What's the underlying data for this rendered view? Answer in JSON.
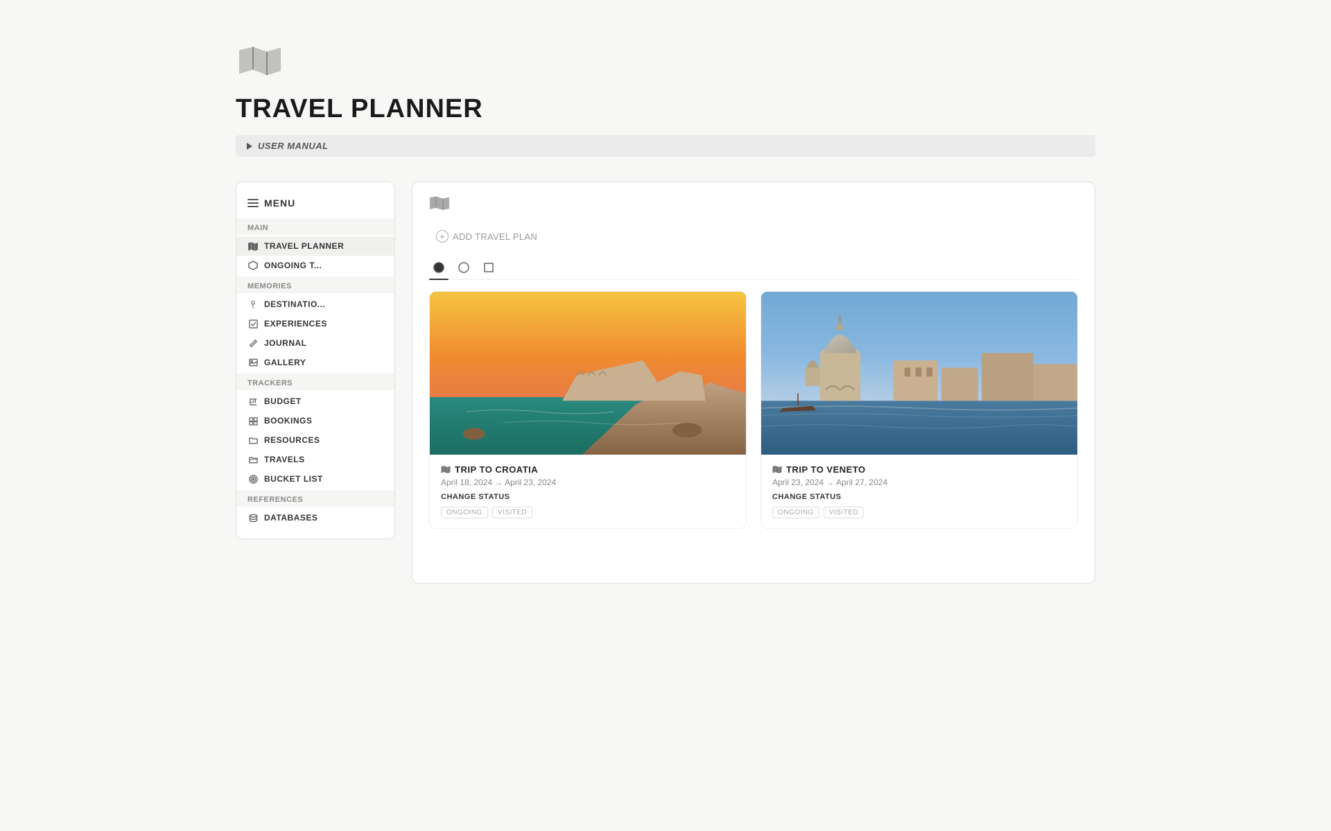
{
  "page": {
    "title": "TRAVEL PLANNER",
    "user_manual_label": "USER MANUAL"
  },
  "sidebar": {
    "menu_label": "MENU",
    "sections": [
      {
        "title": "MAIN",
        "items": [
          {
            "icon": "map-icon",
            "label": "TRAVEL PLANNER",
            "active": true
          },
          {
            "icon": "circle-icon",
            "label": "ONGOING T..."
          }
        ]
      },
      {
        "title": "MEMORIES",
        "items": [
          {
            "icon": "pin-icon",
            "label": "DESTINATIO..."
          },
          {
            "icon": "check-icon",
            "label": "EXPERIENCES"
          },
          {
            "icon": "pencil-icon",
            "label": "JOURNAL"
          },
          {
            "icon": "gallery-icon",
            "label": "GALLERY"
          }
        ]
      },
      {
        "title": "TRACKERS",
        "items": [
          {
            "icon": "budget-icon",
            "label": "BUDGET"
          },
          {
            "icon": "bookings-icon",
            "label": "BOOKINGS"
          },
          {
            "icon": "resources-icon",
            "label": "RESOURCES"
          },
          {
            "icon": "travels-icon",
            "label": "TRAVELS"
          },
          {
            "icon": "target-icon",
            "label": "BUCKET LIST"
          }
        ]
      },
      {
        "title": "REFERENCES",
        "items": [
          {
            "icon": "db-icon",
            "label": "DATABASES"
          }
        ]
      }
    ]
  },
  "content": {
    "add_travel_plan_label": "ADD TRAVEL PLAN",
    "views": [
      {
        "type": "circle-filled",
        "active": true
      },
      {
        "type": "circle-outline"
      },
      {
        "type": "square-outline"
      }
    ],
    "trips": [
      {
        "id": "croatia",
        "name": "TRIP TO CROATIA",
        "date_from": "April 18, 2024",
        "date_to": "April 23, 2024",
        "change_status_label": "CHANGE STATUS",
        "badges": [
          "ONGOING",
          "VISITED"
        ],
        "image_type": "croatia"
      },
      {
        "id": "veneto",
        "name": "TRIP TO VENETO",
        "date_from": "April 23, 2024",
        "date_to": "April 27, 2024",
        "change_status_label": "CHANGE STATUS",
        "badges": [
          "ONGOING",
          "VISITED"
        ],
        "image_type": "veneto"
      }
    ]
  }
}
